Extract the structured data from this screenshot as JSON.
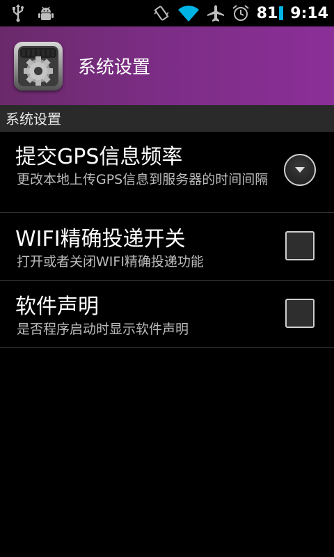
{
  "status_bar": {
    "battery_level": "81",
    "time": "9:14",
    "icons": [
      "usb-icon",
      "android-debug-icon",
      "vibrate-icon",
      "wifi-icon",
      "airplane-icon",
      "alarm-icon",
      "battery-icon"
    ],
    "battery_color": "#00b4e6"
  },
  "title_bar": {
    "title": "系统设置",
    "icon": "settings-gear-icon",
    "background_color": "#8b2f98"
  },
  "category": {
    "label": "系统设置"
  },
  "preferences": [
    {
      "title": "提交GPS信息频率",
      "summary": "更改本地上传GPS信息到服务器的时间间隔",
      "widget": "dropdown"
    },
    {
      "title": "WIFI精确投递开关",
      "summary": "打开或者关闭WIFI精确投递功能",
      "widget": "checkbox",
      "checked": false
    },
    {
      "title": "软件声明",
      "summary": "是否程序启动时显示软件声明",
      "widget": "checkbox",
      "checked": false
    }
  ]
}
